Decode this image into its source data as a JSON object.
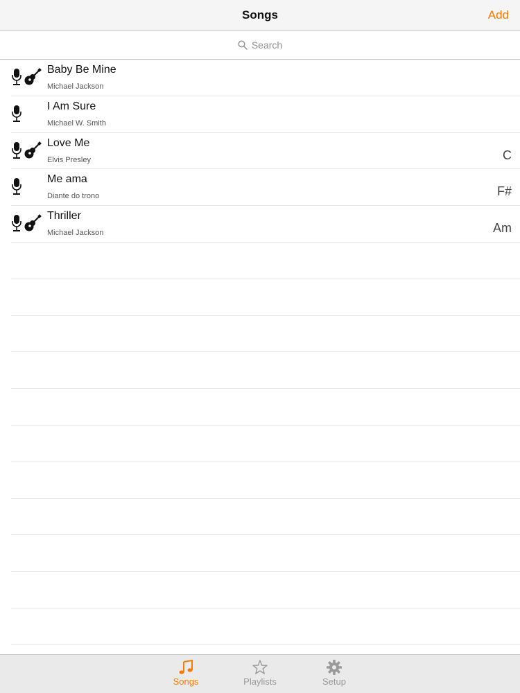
{
  "navbar": {
    "title": "Songs",
    "add_label": "Add"
  },
  "search": {
    "placeholder": "Search"
  },
  "songs": [
    {
      "title": "Baby Be Mine",
      "artist": "Michael Jackson",
      "key": "",
      "mic": true,
      "guitar": true
    },
    {
      "title": "I Am Sure",
      "artist": "Michael W. Smith",
      "key": "",
      "mic": true,
      "guitar": false
    },
    {
      "title": "Love Me",
      "artist": "Elvis Presley",
      "key": "C",
      "mic": true,
      "guitar": true
    },
    {
      "title": "Me ama",
      "artist": "Diante do trono",
      "key": "F#",
      "mic": true,
      "guitar": false
    },
    {
      "title": "Thriller",
      "artist": "Michael Jackson",
      "key": "Am",
      "mic": true,
      "guitar": true
    }
  ],
  "tabbar": {
    "tabs": [
      {
        "label": "Songs",
        "icon": "music-note-icon",
        "active": true
      },
      {
        "label": "Playlists",
        "icon": "star-icon",
        "active": false
      },
      {
        "label": "Setup",
        "icon": "gear-icon",
        "active": false
      }
    ]
  },
  "colors": {
    "accent": "#f57c00",
    "inactive": "#9a9a9a"
  }
}
